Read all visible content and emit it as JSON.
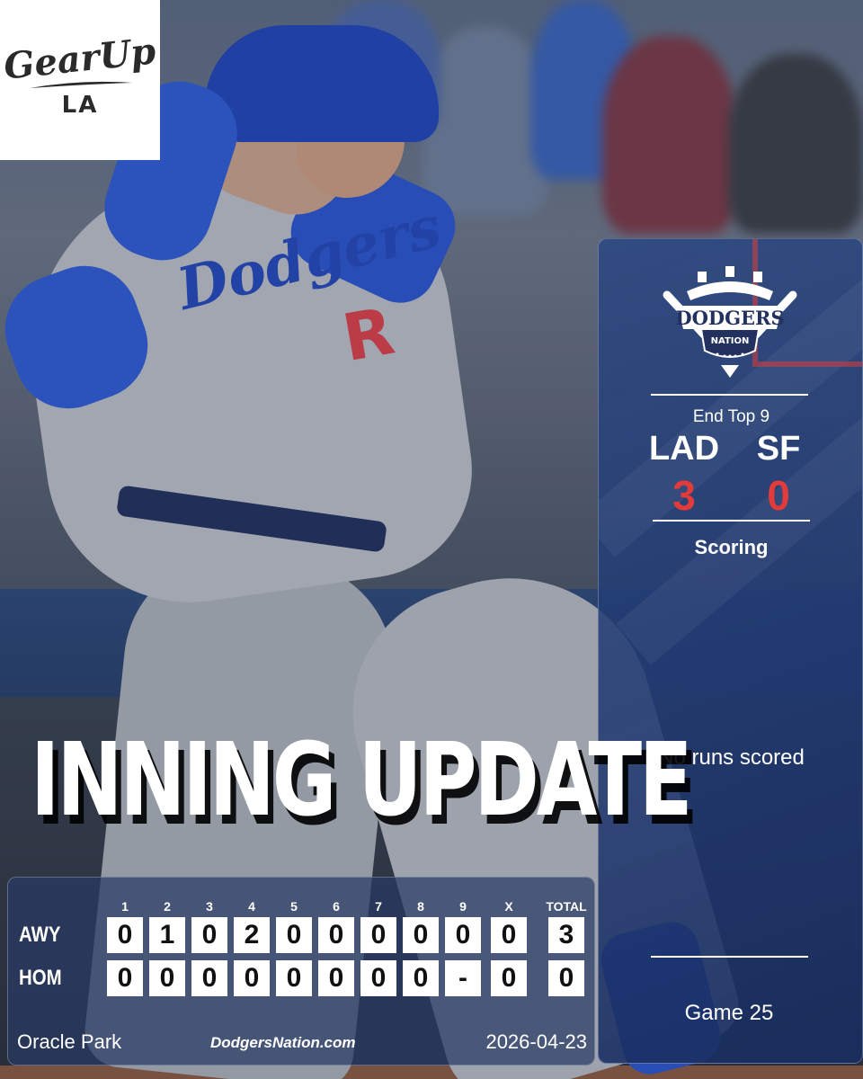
{
  "logo": {
    "word": "GearUp",
    "sub": "LA"
  },
  "crest": {
    "line1": "DODGERS",
    "line2": "NATION"
  },
  "player_jersey": {
    "script": "Dodgers",
    "number": "R"
  },
  "headline": "INNING UPDATE",
  "game_status": "End Top 9",
  "teams": {
    "away": {
      "abbr": "LAD",
      "score": "3"
    },
    "home": {
      "abbr": "SF",
      "score": "0"
    }
  },
  "scoring": {
    "title": "Scoring",
    "summary": "No runs scored"
  },
  "game_label": "Game 25",
  "linescore": {
    "columns": [
      "1",
      "2",
      "3",
      "4",
      "5",
      "6",
      "7",
      "8",
      "9",
      "X",
      "TOTAL"
    ],
    "rows": [
      {
        "label": "AWY",
        "cells": [
          "0",
          "1",
          "0",
          "2",
          "0",
          "0",
          "0",
          "0",
          "0",
          "0"
        ],
        "total": "3"
      },
      {
        "label": "HOM",
        "cells": [
          "0",
          "0",
          "0",
          "0",
          "0",
          "0",
          "0",
          "0",
          "-",
          "0"
        ],
        "total": "0"
      }
    ]
  },
  "footer": {
    "venue": "Oracle Park",
    "site": "DodgersNation.com",
    "date": "2026-04-23"
  },
  "colors": {
    "score_red": "#e33a3a",
    "panel_blue": "#2c4882",
    "dodger_blue": "#2f5bd4"
  }
}
